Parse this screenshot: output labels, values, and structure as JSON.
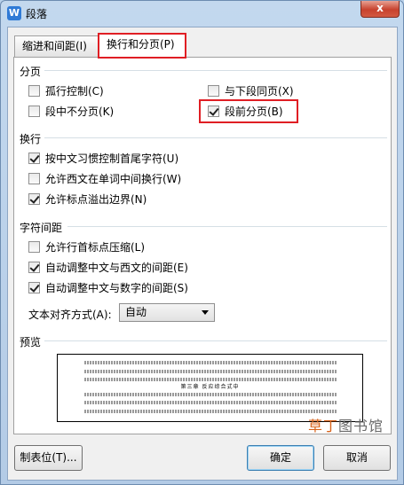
{
  "window": {
    "title": "段落",
    "app_icon": "W",
    "close_label": "x"
  },
  "tabs": [
    {
      "label": "缩进和间距(I)",
      "active": false
    },
    {
      "label": "换行和分页(P)",
      "active": true
    }
  ],
  "pagination": {
    "heading": "分页",
    "items": [
      {
        "label": "孤行控制(C)",
        "checked": false
      },
      {
        "label": "与下段同页(X)",
        "checked": false
      },
      {
        "label": "段中不分页(K)",
        "checked": false
      },
      {
        "label": "段前分页(B)",
        "checked": true
      }
    ]
  },
  "line_breaking": {
    "heading": "换行",
    "items": [
      {
        "label": "按中文习惯控制首尾字符(U)",
        "checked": true
      },
      {
        "label": "允许西文在单词中间换行(W)",
        "checked": false
      },
      {
        "label": "允许标点溢出边界(N)",
        "checked": true
      }
    ]
  },
  "char_spacing": {
    "heading": "字符间距",
    "items": [
      {
        "label": "允许行首标点压缩(L)",
        "checked": false
      },
      {
        "label": "自动调整中文与西文的间距(E)",
        "checked": true
      },
      {
        "label": "自动调整中文与数字的间距(S)",
        "checked": true
      }
    ],
    "align_label": "文本对齐方式(A):",
    "align_value": "自动"
  },
  "preview": {
    "heading": "预览",
    "sample_title": "第三章 反应综合式中"
  },
  "buttons": {
    "tabs_button": "制表位(T)...",
    "ok": "确定",
    "cancel": "取消"
  },
  "watermark": {
    "tag_text": "草丁",
    "rest_text": "图书馆"
  },
  "colors": {
    "highlight": "#e01e24"
  }
}
